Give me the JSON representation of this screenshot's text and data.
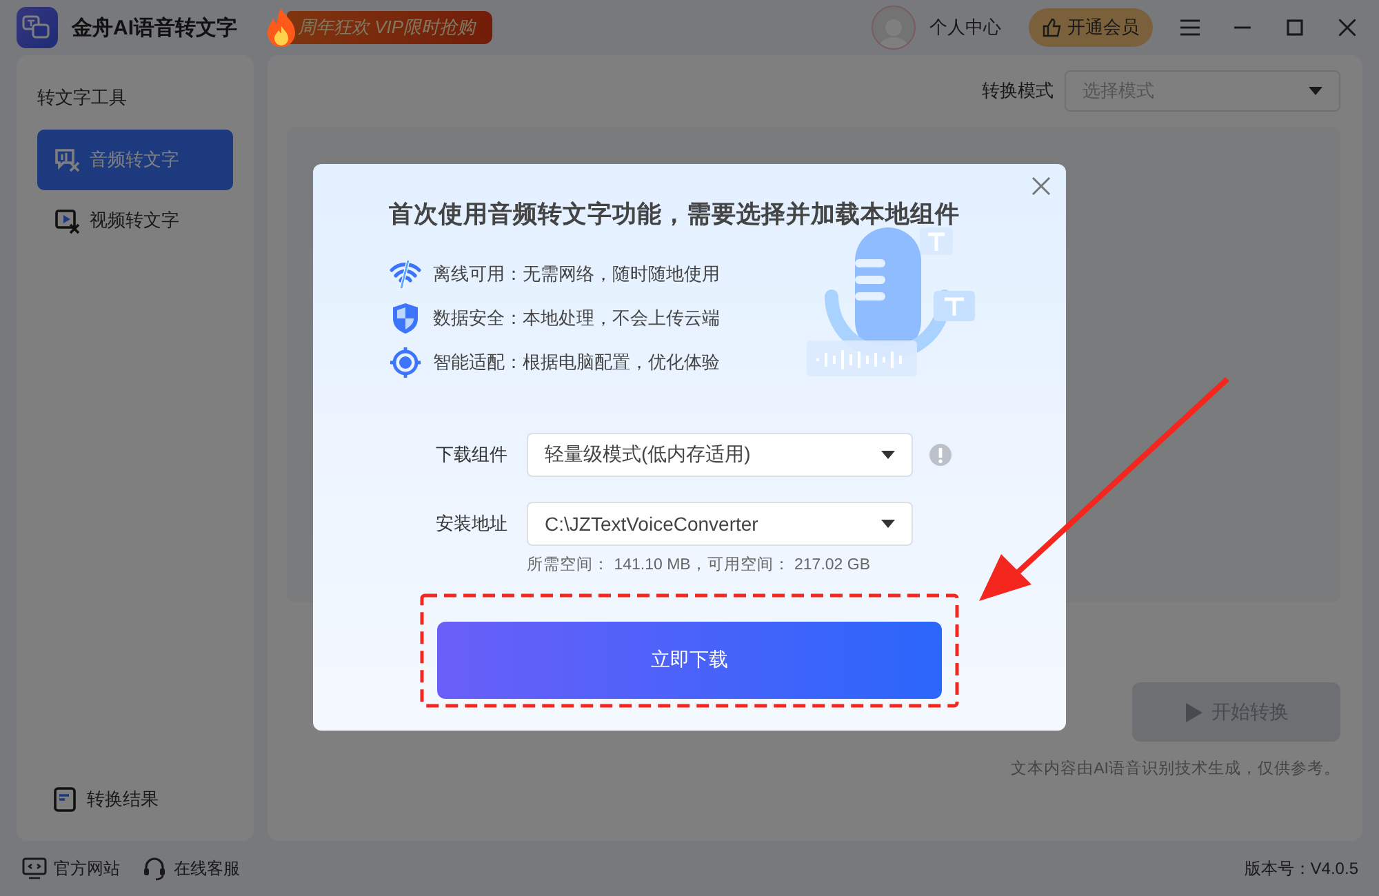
{
  "app": {
    "title": "金舟AI语音转文字",
    "promo": "周年狂欢 VIP限时抢购",
    "user_label": "个人中心",
    "vip_button": "开通会员"
  },
  "sidebar": {
    "heading": "转文字工具",
    "items": [
      {
        "label": "音频转文字",
        "kind": "audio",
        "selected": true
      },
      {
        "label": "视频转文字",
        "kind": "video",
        "selected": false
      }
    ],
    "results": "转换结果"
  },
  "main": {
    "mode_label": "转换模式",
    "mode_select": {
      "placeholder": "选择模式"
    },
    "start_button": {
      "label": "开始转换",
      "disabled": true
    },
    "note": "文本内容由AI语音识别技术生成，仅供参考。"
  },
  "footer": {
    "links": [
      {
        "label": "官方网站",
        "kind": "website"
      },
      {
        "label": "在线客服",
        "kind": "support"
      }
    ],
    "version": "版本号：V4.0.5"
  },
  "dialog": {
    "title": "首次使用音频转文字功能，需要选择并加载本地组件",
    "features": [
      {
        "text": "离线可用：无需网络，随时随地使用",
        "kind": "offline"
      },
      {
        "text": "数据安全：本地处理，不会上传云端",
        "kind": "secure"
      },
      {
        "text": "智能适配：根据电脑配置，优化体验",
        "kind": "adapt"
      }
    ],
    "fields": [
      {
        "label": "下载组件",
        "value": "轻量级模式(低内存适用)",
        "info": true
      },
      {
        "label": "安装地址",
        "value": "C:\\JZTextVoiceConverter",
        "info": false
      }
    ],
    "space_hint": "所需空间： 141.10 MB，可用空间： 217.02 GB",
    "download_button": "立即下载"
  }
}
